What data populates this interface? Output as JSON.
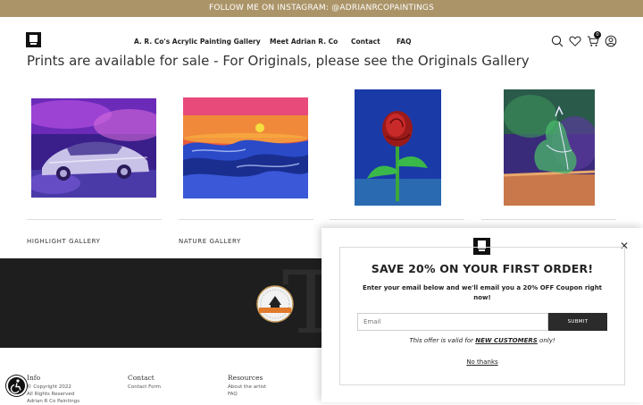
{
  "announcement": "FOLLOW ME ON INSTAGRAM: @ADRIANRCOPAINTINGS",
  "nav": {
    "items": [
      "A. R. Co's Acrylic Painting Gallery",
      "Meet Adrian R. Co",
      "Contact",
      "FAQ"
    ],
    "cart_count": "0",
    "icons": [
      "search-icon",
      "heart-icon",
      "cart-icon",
      "account-icon"
    ]
  },
  "page_heading": "Prints are available for sale - For Originals, please see the Originals Gallery",
  "galleries": [
    {
      "label": "HIGHLIGHT GALLERY"
    },
    {
      "label": "NATURE GALLERY"
    },
    {
      "label": ""
    },
    {
      "label": ""
    }
  ],
  "colors": {
    "announcement_bg": "#ab9468",
    "dark_band": "#1e1e1e",
    "submit_bg": "#2b2b2b"
  },
  "footer": {
    "info": {
      "heading": "Info",
      "lines": [
        "© Copyright 2022",
        "All Rights Reserved",
        "Adrian R Co Paintings"
      ]
    },
    "contact": {
      "heading": "Contact",
      "lines": [
        "Contact Form"
      ]
    },
    "resources": {
      "heading": "Resources",
      "lines": [
        "About the artist",
        "FAQ"
      ]
    }
  },
  "popup": {
    "title": "SAVE 20% ON YOUR FIRST ORDER!",
    "subtitle": "Enter your email below and we'll email you a 20% OFF Coupon right now!",
    "email_placeholder": "Email",
    "submit_label": "SUBMIT",
    "offer_prefix": "This offer is valid for ",
    "offer_highlight": "NEW CUSTOMERS",
    "offer_suffix": " only!",
    "no_thanks": "No thanks",
    "close_icon": "close-icon"
  }
}
